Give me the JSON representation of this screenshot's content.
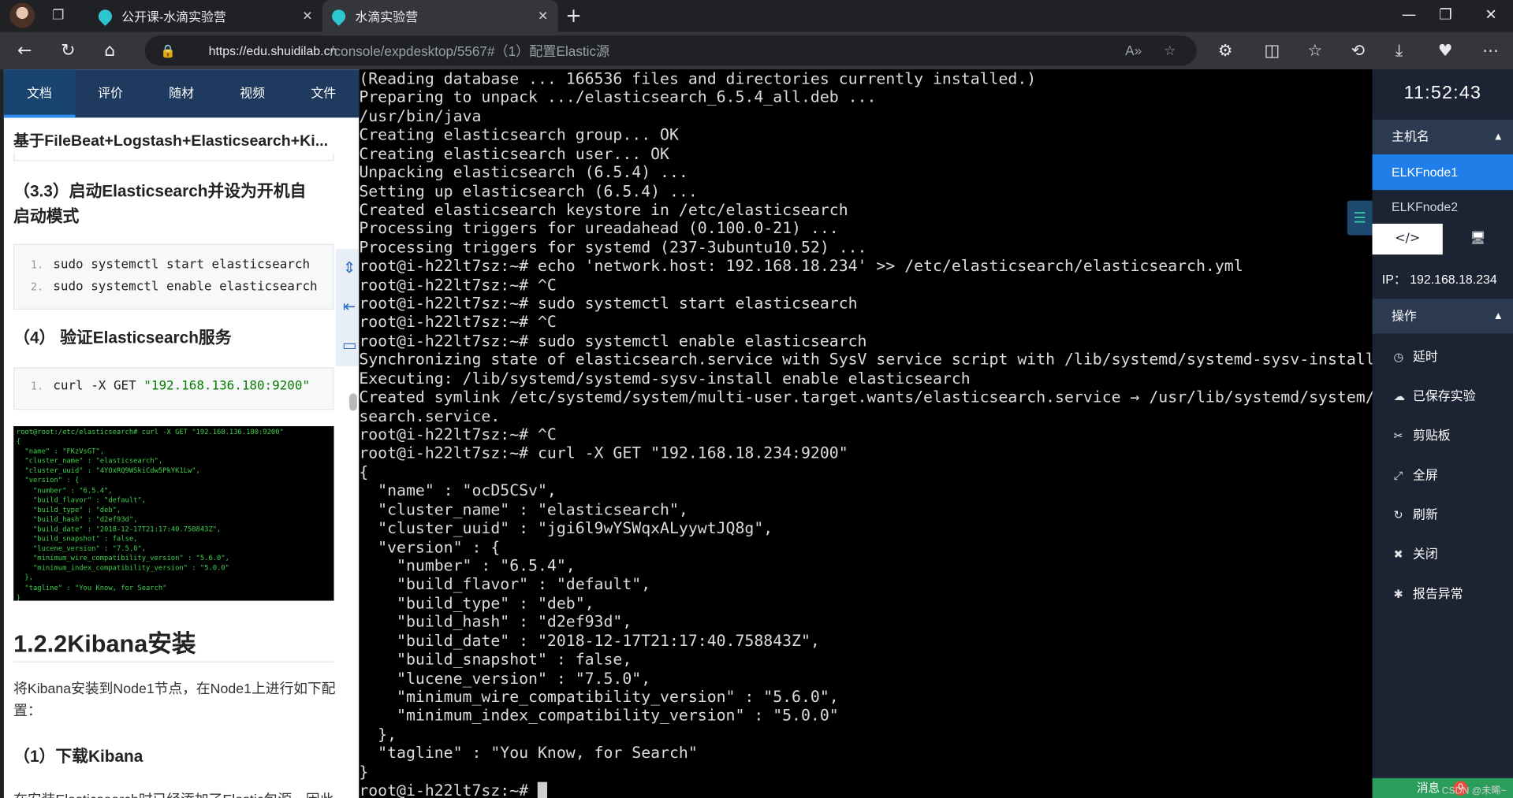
{
  "browser": {
    "tabs": [
      {
        "title": "公开课-水滴实验营"
      },
      {
        "title": "水滴实验营"
      }
    ],
    "url_host": "https://edu.shuidilab.cn",
    "url_path": "/console/expdesktop/5567#（1）配置Elastic源"
  },
  "left_panel": {
    "tabs": [
      "文档",
      "评价",
      "随材",
      "视频",
      "文件"
    ],
    "doc_title": "基于FileBeat+Logstash+Elasticsearch+Ki...",
    "section_33": "（3.3）启动Elasticsearch并设为开机自启动模式",
    "code1": [
      {
        "n": "1.",
        "text": "sudo systemctl start elasticsearch"
      },
      {
        "n": "2.",
        "text": "sudo systemctl enable elasticsearch"
      }
    ],
    "section_4": "（4） 验证Elasticsearch服务",
    "code2_cmd": "curl -X GET ",
    "code2_str": "\"192.168.136.180:9200\"",
    "code2_n": "1.",
    "screenshot_text": "root@root:/etc/elasticsearch# curl -X GET \"192.168.136.180:9200\"\n{\n  \"name\" : \"FKzVsGT\",\n  \"cluster_name\" : \"elasticsearch\",\n  \"cluster_uuid\" : \"4YOxRQ9WSkiCdw5PkYK1Lw\",\n  \"version\" : {\n    \"number\" : \"6.5.4\",\n    \"build_flavor\" : \"default\",\n    \"build_type\" : \"deb\",\n    \"build_hash\" : \"d2ef93d\",\n    \"build_date\" : \"2018-12-17T21:17:40.758843Z\",\n    \"build_snapshot\" : false,\n    \"lucene_version\" : \"7.5.0\",\n    \"minimum_wire_compatibility_version\" : \"5.6.0\",\n    \"minimum_index_compatibility_version\" : \"5.0.0\"\n  },\n  \"tagline\" : \"You Know, for Search\"\n}",
    "h2": "1.2.2Kibana安装",
    "para": "将Kibana安装到Node1节点，在Node1上进行如下配置：",
    "section_1": "（1）下载Kibana",
    "cut_para": "在安装Elasticsearch时已经添加了Elastic包源，因此"
  },
  "terminal": {
    "lines": [
      "(Reading database ... 166536 files and directories currently installed.)",
      "Preparing to unpack .../elasticsearch_6.5.4_all.deb ...",
      "/usr/bin/java",
      "Creating elasticsearch group... OK",
      "Creating elasticsearch user... OK",
      "Unpacking elasticsearch (6.5.4) ...",
      "Setting up elasticsearch (6.5.4) ...",
      "Created elasticsearch keystore in /etc/elasticsearch",
      "Processing triggers for ureadahead (0.100.0-21) ...",
      "Processing triggers for systemd (237-3ubuntu10.52) ...",
      "root@i-h22lt7sz:~# echo 'network.host: 192.168.18.234' >> /etc/elasticsearch/elasticsearch.yml",
      "root@i-h22lt7sz:~# ^C",
      "root@i-h22lt7sz:~# sudo systemctl start elasticsearch",
      "root@i-h22lt7sz:~# ^C",
      "root@i-h22lt7sz:~# sudo systemctl enable elasticsearch",
      "Synchronizing state of elasticsearch.service with SysV service script with /lib/systemd/systemd-sysv-install.",
      "Executing: /lib/systemd/systemd-sysv-install enable elasticsearch",
      "Created symlink /etc/systemd/system/multi-user.target.wants/elasticsearch.service → /usr/lib/systemd/system/elastic",
      "search.service.",
      "root@i-h22lt7sz:~# ^C",
      "root@i-h22lt7sz:~# curl -X GET \"192.168.18.234:9200\"",
      "{",
      "  \"name\" : \"ocD5CSv\",",
      "  \"cluster_name\" : \"elasticsearch\",",
      "  \"cluster_uuid\" : \"jgi6l9wYSWqxALyywtJQ8g\",",
      "  \"version\" : {",
      "    \"number\" : \"6.5.4\",",
      "    \"build_flavor\" : \"default\",",
      "    \"build_type\" : \"deb\",",
      "    \"build_hash\" : \"d2ef93d\",",
      "    \"build_date\" : \"2018-12-17T21:17:40.758843Z\",",
      "    \"build_snapshot\" : false,",
      "    \"lucene_version\" : \"7.5.0\",",
      "    \"minimum_wire_compatibility_version\" : \"5.6.0\",",
      "    \"minimum_index_compatibility_version\" : \"5.0.0\"",
      "  },",
      "  \"tagline\" : \"You Know, for Search\"",
      "}"
    ],
    "prompt": "root@i-h22lt7sz:~# "
  },
  "right_panel": {
    "clock": "11:52:43",
    "hostname_label": "主机名",
    "hosts": [
      "ELKFnode1",
      "ELKFnode2"
    ],
    "ip": "IP： 192.168.18.234",
    "ops_label": "操作",
    "ops": [
      {
        "icon": "clock-icon",
        "label": "延时"
      },
      {
        "icon": "cloud-icon",
        "label": "已保存实验"
      },
      {
        "icon": "scissors-icon",
        "label": "剪贴板"
      },
      {
        "icon": "expand-icon",
        "label": "全屏"
      },
      {
        "icon": "refresh-icon",
        "label": "刷新"
      },
      {
        "icon": "close-icon",
        "label": "关闭"
      },
      {
        "icon": "bug-icon",
        "label": "报告异常"
      }
    ],
    "msg_label": "消息",
    "msg_count": "0",
    "watermark": "CSDN @未晞~"
  },
  "colors": {
    "accent": "#1f7ee8",
    "panel": "#1c2434",
    "nav": "#1e3a5f"
  }
}
